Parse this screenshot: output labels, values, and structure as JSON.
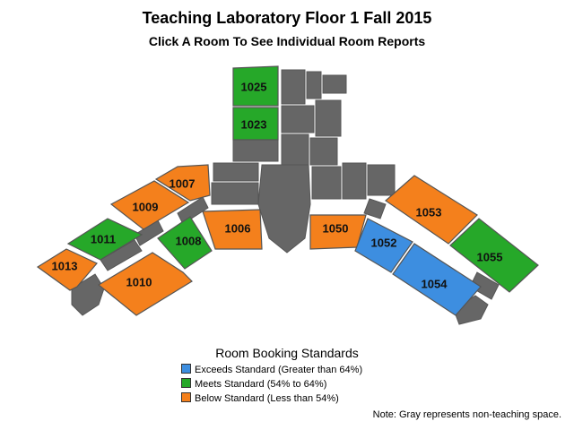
{
  "title": "Teaching Laboratory Floor 1 Fall 2015",
  "subtitle": "Click A Room To See Individual Room Reports",
  "colors": {
    "exceeds": "#3d8ee0",
    "meets": "#26a829",
    "below": "#f4801c",
    "non_teaching": "#666666"
  },
  "rooms": [
    {
      "id": "1025",
      "label": "1025",
      "status": "meets"
    },
    {
      "id": "1023",
      "label": "1023",
      "status": "meets"
    },
    {
      "id": "1007",
      "label": "1007",
      "status": "below"
    },
    {
      "id": "1009",
      "label": "1009",
      "status": "below"
    },
    {
      "id": "1011",
      "label": "1011",
      "status": "meets"
    },
    {
      "id": "1013",
      "label": "1013",
      "status": "below"
    },
    {
      "id": "1008",
      "label": "1008",
      "status": "meets"
    },
    {
      "id": "1010",
      "label": "1010",
      "status": "below"
    },
    {
      "id": "1006",
      "label": "1006",
      "status": "below"
    },
    {
      "id": "1050",
      "label": "1050",
      "status": "below"
    },
    {
      "id": "1052",
      "label": "1052",
      "status": "exceeds"
    },
    {
      "id": "1053",
      "label": "1053",
      "status": "below"
    },
    {
      "id": "1054",
      "label": "1054",
      "status": "exceeds"
    },
    {
      "id": "1055",
      "label": "1055",
      "status": "meets"
    }
  ],
  "legend": {
    "title": "Room Booking Standards",
    "items": [
      {
        "status": "exceeds",
        "label": "Exceeds Standard (Greater than 64%)"
      },
      {
        "status": "meets",
        "label": "Meets Standard (54% to 64%)"
      },
      {
        "status": "below",
        "label": "Below Standard (Less than 54%)"
      }
    ]
  },
  "note": "Note: Gray represents non-teaching space."
}
